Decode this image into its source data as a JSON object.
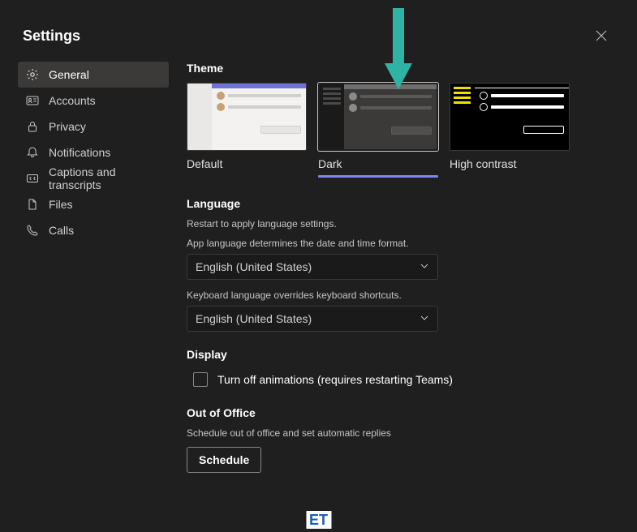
{
  "header": {
    "title": "Settings"
  },
  "sidebar": {
    "items": [
      {
        "label": "General",
        "icon": "gear-icon",
        "active": true
      },
      {
        "label": "Accounts",
        "icon": "id-card-icon"
      },
      {
        "label": "Privacy",
        "icon": "lock-icon"
      },
      {
        "label": "Notifications",
        "icon": "bell-icon"
      },
      {
        "label": "Captions and transcripts",
        "icon": "cc-icon"
      },
      {
        "label": "Files",
        "icon": "file-icon"
      },
      {
        "label": "Calls",
        "icon": "phone-icon"
      }
    ]
  },
  "theme": {
    "title": "Theme",
    "options": [
      {
        "label": "Default"
      },
      {
        "label": "Dark",
        "selected": true
      },
      {
        "label": "High contrast"
      }
    ]
  },
  "language": {
    "title": "Language",
    "restart_note": "Restart to apply language settings.",
    "app_lang_label": "App language determines the date and time format.",
    "app_lang_value": "English (United States)",
    "kb_lang_label": "Keyboard language overrides keyboard shortcuts.",
    "kb_lang_value": "English (United States)"
  },
  "display": {
    "title": "Display",
    "animations_label": "Turn off animations (requires restarting Teams)"
  },
  "ooo": {
    "title": "Out of Office",
    "subtext": "Schedule out of office and set automatic replies",
    "button": "Schedule"
  },
  "badge": "ET"
}
